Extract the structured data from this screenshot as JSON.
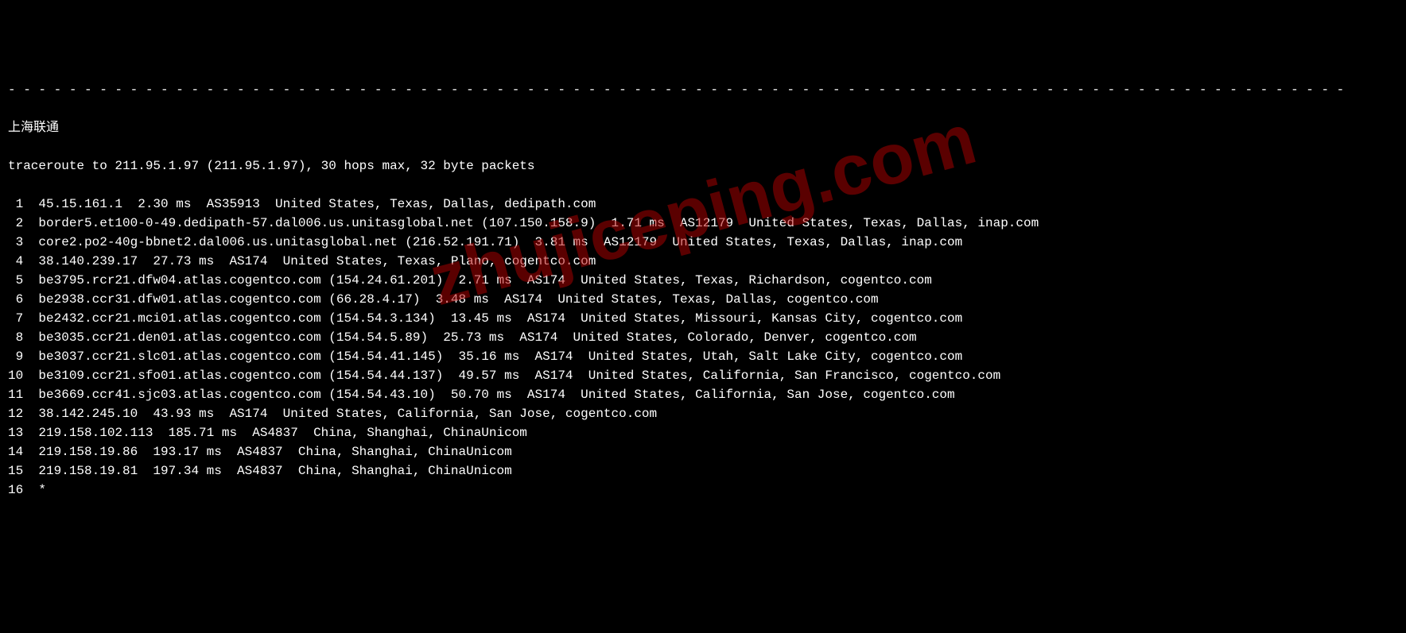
{
  "separator_line": "- - - - - - - - - - - - - - - - - - - - - - - - - - - - - - - - - - - - - - - - - - - - - - - - - - - - - - - - - - - - - - - - - - - - - - - - - - - - - - - - - - - - - - - -",
  "title": "上海联通",
  "traceroute_header": "traceroute to 211.95.1.97 (211.95.1.97), 30 hops max, 32 byte packets",
  "watermark_text": "zhujiceping.com",
  "hops": [
    {
      "line": " 1  45.15.161.1  2.30 ms  AS35913  United States, Texas, Dallas, dedipath.com"
    },
    {
      "line": " 2  border5.et100-0-49.dedipath-57.dal006.us.unitasglobal.net (107.150.158.9)  1.71 ms  AS12179  United States, Texas, Dallas, inap.com"
    },
    {
      "line": " 3  core2.po2-40g-bbnet2.dal006.us.unitasglobal.net (216.52.191.71)  3.81 ms  AS12179  United States, Texas, Dallas, inap.com"
    },
    {
      "line": " 4  38.140.239.17  27.73 ms  AS174  United States, Texas, Plano, cogentco.com"
    },
    {
      "line": " 5  be3795.rcr21.dfw04.atlas.cogentco.com (154.24.61.201)  2.71 ms  AS174  United States, Texas, Richardson, cogentco.com"
    },
    {
      "line": " 6  be2938.ccr31.dfw01.atlas.cogentco.com (66.28.4.17)  3.48 ms  AS174  United States, Texas, Dallas, cogentco.com"
    },
    {
      "line": " 7  be2432.ccr21.mci01.atlas.cogentco.com (154.54.3.134)  13.45 ms  AS174  United States, Missouri, Kansas City, cogentco.com"
    },
    {
      "line": " 8  be3035.ccr21.den01.atlas.cogentco.com (154.54.5.89)  25.73 ms  AS174  United States, Colorado, Denver, cogentco.com"
    },
    {
      "line": " 9  be3037.ccr21.slc01.atlas.cogentco.com (154.54.41.145)  35.16 ms  AS174  United States, Utah, Salt Lake City, cogentco.com"
    },
    {
      "line": "10  be3109.ccr21.sfo01.atlas.cogentco.com (154.54.44.137)  49.57 ms  AS174  United States, California, San Francisco, cogentco.com"
    },
    {
      "line": "11  be3669.ccr41.sjc03.atlas.cogentco.com (154.54.43.10)  50.70 ms  AS174  United States, California, San Jose, cogentco.com"
    },
    {
      "line": "12  38.142.245.10  43.93 ms  AS174  United States, California, San Jose, cogentco.com"
    },
    {
      "line": "13  219.158.102.113  185.71 ms  AS4837  China, Shanghai, ChinaUnicom"
    },
    {
      "line": "14  219.158.19.86  193.17 ms  AS4837  China, Shanghai, ChinaUnicom"
    },
    {
      "line": "15  219.158.19.81  197.34 ms  AS4837  China, Shanghai, ChinaUnicom"
    },
    {
      "line": "16  *"
    }
  ]
}
